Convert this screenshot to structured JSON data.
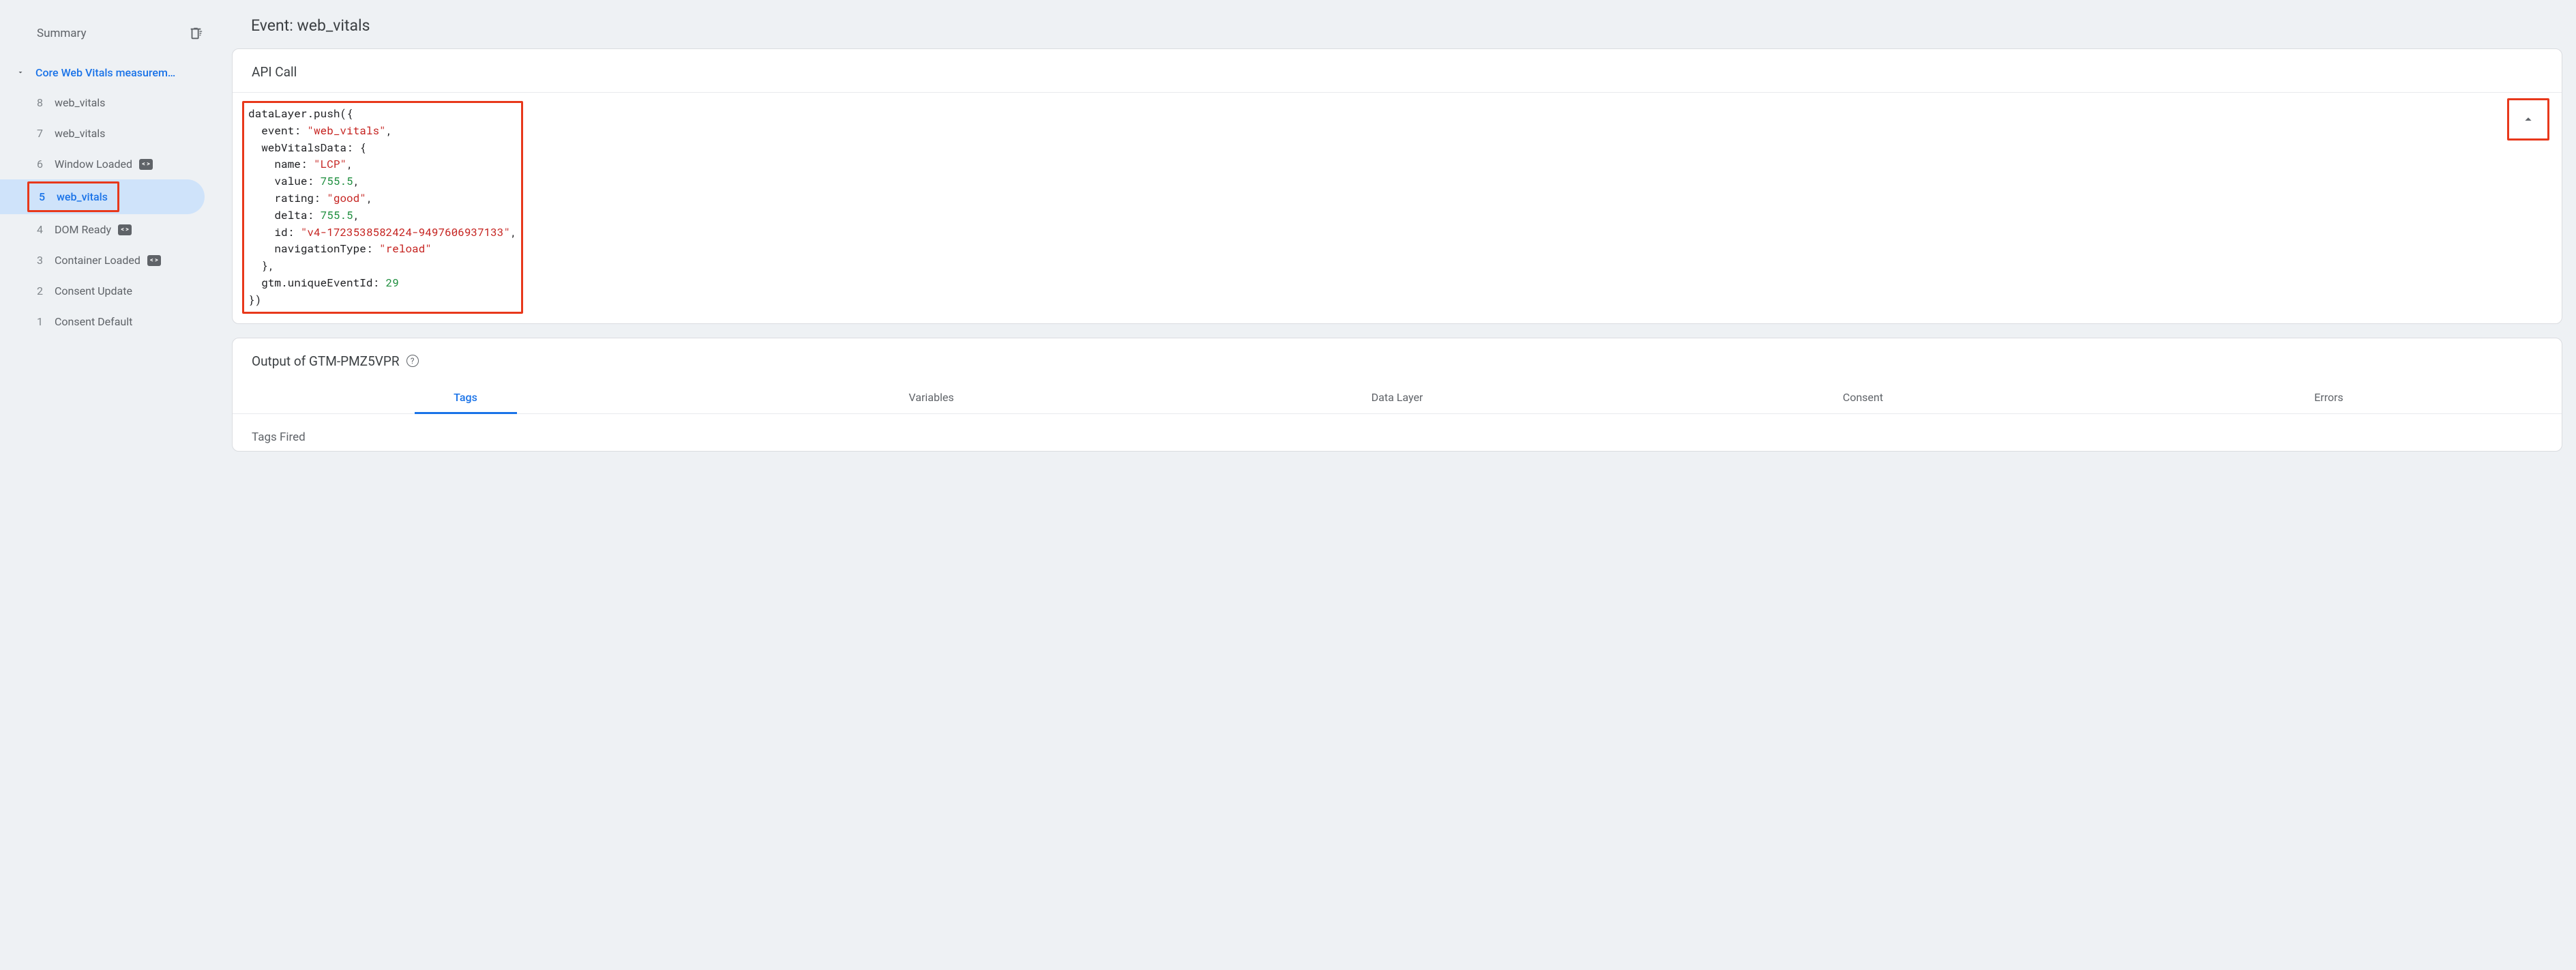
{
  "sidebar": {
    "title": "Summary",
    "tree_title": "Core Web Vitals measurem…",
    "events": [
      {
        "num": "8",
        "label": "web_vitals",
        "badge": false,
        "selected": false
      },
      {
        "num": "7",
        "label": "web_vitals",
        "badge": false,
        "selected": false
      },
      {
        "num": "6",
        "label": "Window Loaded",
        "badge": true,
        "selected": false
      },
      {
        "num": "5",
        "label": "web_vitals",
        "badge": false,
        "selected": true
      },
      {
        "num": "4",
        "label": "DOM Ready",
        "badge": true,
        "selected": false
      },
      {
        "num": "3",
        "label": "Container Loaded",
        "badge": true,
        "selected": false
      },
      {
        "num": "2",
        "label": "Consent Update",
        "badge": false,
        "selected": false
      },
      {
        "num": "1",
        "label": "Consent Default",
        "badge": false,
        "selected": false
      }
    ]
  },
  "main": {
    "event_title": "Event: web_vitals",
    "api_call_header": "API Call",
    "api_call": {
      "open": "dataLayer.push({",
      "event_key": "event:",
      "event_val": "\"web_vitals\"",
      "wvd_key": "webVitalsData: {",
      "name_key": "name:",
      "name_val": "\"LCP\"",
      "value_key": "value:",
      "value_val": "755.5",
      "rating_key": "rating:",
      "rating_val": "\"good\"",
      "delta_key": "delta:",
      "delta_val": "755.5",
      "id_key": "id:",
      "id_val": "\"v4-1723538582424-9497606937133\"",
      "nav_key": "navigationType:",
      "nav_val": "\"reload\"",
      "wvd_close": "},",
      "gtm_key": "gtm.uniqueEventId:",
      "gtm_val": "29",
      "close": "})"
    },
    "output_header": "Output of GTM-PMZ5VPR",
    "tabs": [
      "Tags",
      "Variables",
      "Data Layer",
      "Consent",
      "Errors"
    ],
    "active_tab": 0,
    "tags_fired_label": "Tags Fired"
  }
}
